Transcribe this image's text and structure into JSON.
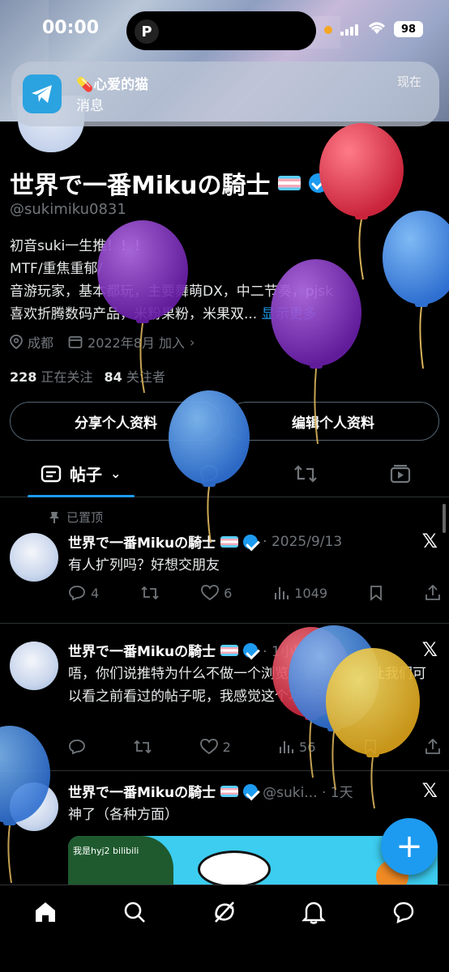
{
  "status_bar": {
    "time": "00:00",
    "battery": "98",
    "island_app": "P"
  },
  "notification": {
    "title": "💊心爱的猫",
    "subtitle": "消息",
    "time": "现在",
    "app_icon": "telegram-icon"
  },
  "profile": {
    "name": "世界で一番Mikuの騎士",
    "handle": "@sukimiku0831",
    "bio_lines": [
      "初音suki一生推！！！",
      "MTF/重焦重郁/",
      "音游玩家，基本都玩，主要舞萌DX，中二节奏，pjsk",
      "喜欢折腾数码产品，米粉果粉，米果双..."
    ],
    "bio_more": "显示更多",
    "location": "成都",
    "joined": "2022年8月 加入",
    "following_count": "228",
    "following_label": "正在关注",
    "followers_count": "84",
    "followers_label": "关注者",
    "share_button": "分享个人资料",
    "edit_button": "编辑个人资料"
  },
  "tabs": {
    "posts": "帖子"
  },
  "pinned_label": "已置顶",
  "posts": [
    {
      "name": "世界で一番Mikuの騎士",
      "meta": "· 2025/9/13",
      "text": "有人扩列吗？好想交朋友",
      "replies": "4",
      "retweets": "",
      "likes": "6",
      "views": "1049"
    },
    {
      "name": "世界で一番Mikuの騎士",
      "meta": "· 1小时",
      "text": "唔，你们说推特为什么不做一个浏览记录的功能，让我们可以看之前看过的帖子呢，我感觉这个功能会很好用",
      "replies": "",
      "retweets": "",
      "likes": "2",
      "views": "56"
    },
    {
      "name": "世界で一番Mikuの騎士",
      "meta": "@suki... · 1天",
      "text": "神了（各种方面）",
      "media_label": "我是hyj2 bilibili"
    }
  ],
  "colors": {
    "accent": "#1d9bf0",
    "secondary_text": "#71767b",
    "border": "#2f3336"
  }
}
